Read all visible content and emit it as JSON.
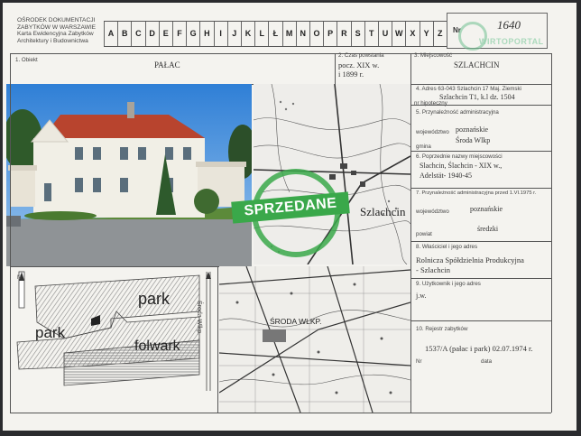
{
  "header": {
    "org_lines": [
      "OŚRODEK DOKUMENTACJI",
      "ZABYTKÓW W WARSZAWIE",
      "Karta Ewidencyjna Zabytków",
      "Architektury i Budownictwa"
    ],
    "letters": [
      "A",
      "B",
      "C",
      "D",
      "E",
      "F",
      "G",
      "H",
      "I",
      "J",
      "K",
      "L",
      "Ł",
      "M",
      "N",
      "O",
      "P",
      "R",
      "S",
      "T",
      "U",
      "W",
      "X",
      "Y",
      "Z"
    ],
    "nr_label": "Nr",
    "nr_value": "1640",
    "watermark": "WIRTOPORTAL"
  },
  "fields": {
    "obiekt_label": "1. Obiekt",
    "obiekt_value": "PAŁAC",
    "czas_label": "2. Czas powstania",
    "czas_value1": "pocz. XIX w.",
    "czas_value2": "i 1899 r.",
    "miejsc_label": "3. Miejscowość",
    "miejsc_value": "SZLACHCIN",
    "adres_label": "4. Adres 63-043 Szlachcin 17 Maj. Ziemski",
    "adres_value": "Szlachcin T1, k.l dz. 1504",
    "hipot_label": "nr hipoteczny",
    "przyn_label": "5. Przynależność administracyjna",
    "woj_label": "województwo",
    "woj_value": "poznańskie",
    "gmina_value": "Środa Wlkp",
    "gmina_label": "gmina",
    "poprz_label": "6. Poprzednie nazwy miejscowości",
    "poprz_value1": "Slachcin, Ślachcin - XIX w.,",
    "poprz_value2": "Adelstät- 1940-45",
    "przyn75_label": "7. Przynależność administracyjna przed 1.VI.1975 r.",
    "woj2_label": "województwo",
    "woj2_value": "poznańskie",
    "powiat_value": "średzki",
    "powiat_label": "powiat",
    "wlasc_label": "8. Właściciel i jego adres",
    "wlasc_value1": "Rolnicza Spółdzielnia Produkcyjna",
    "wlasc_value2": "- Szlachcin",
    "uzytk_label": "9. Użytkownik i jego adres",
    "uzytk_value": "j.w.",
    "rejestr_label": "10. Rejestr zabytków",
    "rejestr_value": "1537/A (pałac i park) 02.07.1974 r.",
    "nr_label": "Nr",
    "data_label": "data"
  },
  "stamp": {
    "text": "SPRZEDANE"
  },
  "topo_map": {
    "place_label": "Szlachcin"
  },
  "plan": {
    "park_top": "park",
    "park_left": "park",
    "folwark": "folwark",
    "road": "Środa Wlkp.",
    "north": "N"
  },
  "regional_map": {
    "town": "ŚRODA WLKP."
  },
  "colors": {
    "stamp": "#3aa84a",
    "roof": "#b8442e",
    "sky": "#4a8fd8"
  }
}
